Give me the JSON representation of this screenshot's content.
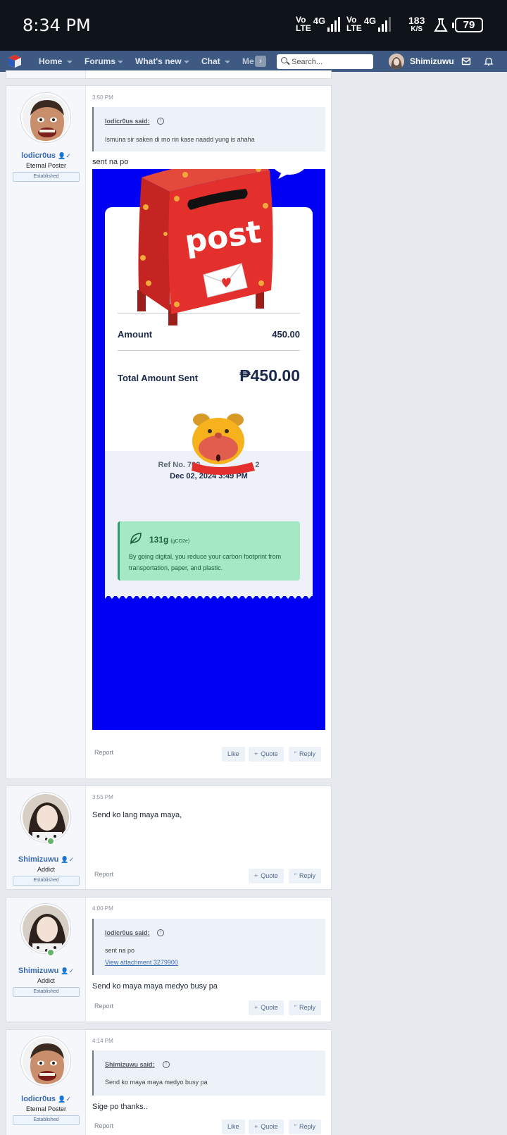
{
  "status_bar": {
    "time": "8:34 PM",
    "volte1_top": "Vo",
    "volte1_bottom": "LTE",
    "net1": "4G",
    "volte2_top": "Vo",
    "volte2_bottom": "LTE",
    "net2": "4G",
    "speed_value": "183",
    "speed_unit": "K/S",
    "battery": "79"
  },
  "nav": {
    "items": [
      {
        "label": "Home"
      },
      {
        "label": "Forums"
      },
      {
        "label": "What's new"
      },
      {
        "label": "Chat"
      },
      {
        "label": "Me"
      }
    ],
    "search_placeholder": "Search...",
    "username": "Shimizuwu"
  },
  "posts": [
    {
      "username": "lodicr0us",
      "user_title": "Eternal Poster",
      "banner": "Established",
      "time": "3:50 PM",
      "quote_author": "lodicr0us said:",
      "quote_text": "Ismuna sir saken di mo rin kase naadd yung is ahaha",
      "message": "sent na po",
      "attachment": {
        "amount_label": "Amount",
        "amount_value": "450.00",
        "total_label": "Total Amount Sent",
        "total_value": "₱450.00",
        "ref_label": "Ref No. 702",
        "ref_suffix": "2",
        "date": "Dec 02, 2024 3:49 PM",
        "carbon_value": "131g",
        "carbon_unit": "(gCO2e)",
        "carbon_text": "By going digital, you reduce your carbon footprint from transportation, paper, and plastic.",
        "sticker_text": "post"
      },
      "report": "Report",
      "like": "Like",
      "quote": "Quote",
      "reply": "Reply"
    },
    {
      "username": "Shimizuwu",
      "user_title": "Addict",
      "banner": "Established",
      "time": "3:55 PM",
      "message": "Send ko lang maya maya,",
      "report": "Report",
      "quote": "Quote",
      "reply": "Reply"
    },
    {
      "username": "Shimizuwu",
      "user_title": "Addict",
      "banner": "Established",
      "time": "4:00 PM",
      "quote_author": "lodicr0us said:",
      "quote_text": "sent na po",
      "quote_link": "View attachment 3279900",
      "message": "Send ko maya maya medyo busy pa",
      "report": "Report",
      "quote": "Quote",
      "reply": "Reply"
    },
    {
      "username": "lodicr0us",
      "user_title": "Eternal Poster",
      "banner": "Established",
      "time": "4:14 PM",
      "quote_author": "Shimizuwu said:",
      "quote_text": "Send ko maya maya medyo busy pa",
      "message": "Sige po thanks..",
      "report": "Report",
      "like": "Like",
      "quote": "Quote",
      "reply": "Reply"
    }
  ],
  "colors": {
    "nav_bg": "#3f5a82",
    "username": "#3b6bb3",
    "attachment_bg": "#0000f5",
    "postbox_red": "#e3302c"
  }
}
